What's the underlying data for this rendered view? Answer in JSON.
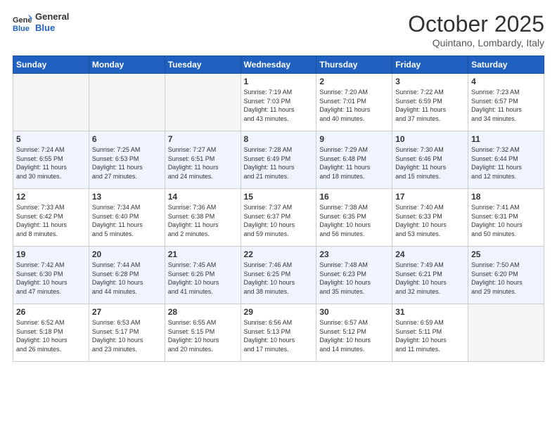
{
  "logo": {
    "line1": "General",
    "line2": "Blue"
  },
  "title": "October 2025",
  "location": "Quintano, Lombardy, Italy",
  "days_of_week": [
    "Sunday",
    "Monday",
    "Tuesday",
    "Wednesday",
    "Thursday",
    "Friday",
    "Saturday"
  ],
  "weeks": [
    [
      {
        "day": "",
        "info": ""
      },
      {
        "day": "",
        "info": ""
      },
      {
        "day": "",
        "info": ""
      },
      {
        "day": "1",
        "info": "Sunrise: 7:19 AM\nSunset: 7:03 PM\nDaylight: 11 hours\nand 43 minutes."
      },
      {
        "day": "2",
        "info": "Sunrise: 7:20 AM\nSunset: 7:01 PM\nDaylight: 11 hours\nand 40 minutes."
      },
      {
        "day": "3",
        "info": "Sunrise: 7:22 AM\nSunset: 6:59 PM\nDaylight: 11 hours\nand 37 minutes."
      },
      {
        "day": "4",
        "info": "Sunrise: 7:23 AM\nSunset: 6:57 PM\nDaylight: 11 hours\nand 34 minutes."
      }
    ],
    [
      {
        "day": "5",
        "info": "Sunrise: 7:24 AM\nSunset: 6:55 PM\nDaylight: 11 hours\nand 30 minutes."
      },
      {
        "day": "6",
        "info": "Sunrise: 7:25 AM\nSunset: 6:53 PM\nDaylight: 11 hours\nand 27 minutes."
      },
      {
        "day": "7",
        "info": "Sunrise: 7:27 AM\nSunset: 6:51 PM\nDaylight: 11 hours\nand 24 minutes."
      },
      {
        "day": "8",
        "info": "Sunrise: 7:28 AM\nSunset: 6:49 PM\nDaylight: 11 hours\nand 21 minutes."
      },
      {
        "day": "9",
        "info": "Sunrise: 7:29 AM\nSunset: 6:48 PM\nDaylight: 11 hours\nand 18 minutes."
      },
      {
        "day": "10",
        "info": "Sunrise: 7:30 AM\nSunset: 6:46 PM\nDaylight: 11 hours\nand 15 minutes."
      },
      {
        "day": "11",
        "info": "Sunrise: 7:32 AM\nSunset: 6:44 PM\nDaylight: 11 hours\nand 12 minutes."
      }
    ],
    [
      {
        "day": "12",
        "info": "Sunrise: 7:33 AM\nSunset: 6:42 PM\nDaylight: 11 hours\nand 8 minutes."
      },
      {
        "day": "13",
        "info": "Sunrise: 7:34 AM\nSunset: 6:40 PM\nDaylight: 11 hours\nand 5 minutes."
      },
      {
        "day": "14",
        "info": "Sunrise: 7:36 AM\nSunset: 6:38 PM\nDaylight: 11 hours\nand 2 minutes."
      },
      {
        "day": "15",
        "info": "Sunrise: 7:37 AM\nSunset: 6:37 PM\nDaylight: 10 hours\nand 59 minutes."
      },
      {
        "day": "16",
        "info": "Sunrise: 7:38 AM\nSunset: 6:35 PM\nDaylight: 10 hours\nand 56 minutes."
      },
      {
        "day": "17",
        "info": "Sunrise: 7:40 AM\nSunset: 6:33 PM\nDaylight: 10 hours\nand 53 minutes."
      },
      {
        "day": "18",
        "info": "Sunrise: 7:41 AM\nSunset: 6:31 PM\nDaylight: 10 hours\nand 50 minutes."
      }
    ],
    [
      {
        "day": "19",
        "info": "Sunrise: 7:42 AM\nSunset: 6:30 PM\nDaylight: 10 hours\nand 47 minutes."
      },
      {
        "day": "20",
        "info": "Sunrise: 7:44 AM\nSunset: 6:28 PM\nDaylight: 10 hours\nand 44 minutes."
      },
      {
        "day": "21",
        "info": "Sunrise: 7:45 AM\nSunset: 6:26 PM\nDaylight: 10 hours\nand 41 minutes."
      },
      {
        "day": "22",
        "info": "Sunrise: 7:46 AM\nSunset: 6:25 PM\nDaylight: 10 hours\nand 38 minutes."
      },
      {
        "day": "23",
        "info": "Sunrise: 7:48 AM\nSunset: 6:23 PM\nDaylight: 10 hours\nand 35 minutes."
      },
      {
        "day": "24",
        "info": "Sunrise: 7:49 AM\nSunset: 6:21 PM\nDaylight: 10 hours\nand 32 minutes."
      },
      {
        "day": "25",
        "info": "Sunrise: 7:50 AM\nSunset: 6:20 PM\nDaylight: 10 hours\nand 29 minutes."
      }
    ],
    [
      {
        "day": "26",
        "info": "Sunrise: 6:52 AM\nSunset: 5:18 PM\nDaylight: 10 hours\nand 26 minutes."
      },
      {
        "day": "27",
        "info": "Sunrise: 6:53 AM\nSunset: 5:17 PM\nDaylight: 10 hours\nand 23 minutes."
      },
      {
        "day": "28",
        "info": "Sunrise: 6:55 AM\nSunset: 5:15 PM\nDaylight: 10 hours\nand 20 minutes."
      },
      {
        "day": "29",
        "info": "Sunrise: 6:56 AM\nSunset: 5:13 PM\nDaylight: 10 hours\nand 17 minutes."
      },
      {
        "day": "30",
        "info": "Sunrise: 6:57 AM\nSunset: 5:12 PM\nDaylight: 10 hours\nand 14 minutes."
      },
      {
        "day": "31",
        "info": "Sunrise: 6:59 AM\nSunset: 5:11 PM\nDaylight: 10 hours\nand 11 minutes."
      },
      {
        "day": "",
        "info": ""
      }
    ]
  ],
  "shaded_rows": [
    1,
    3
  ]
}
